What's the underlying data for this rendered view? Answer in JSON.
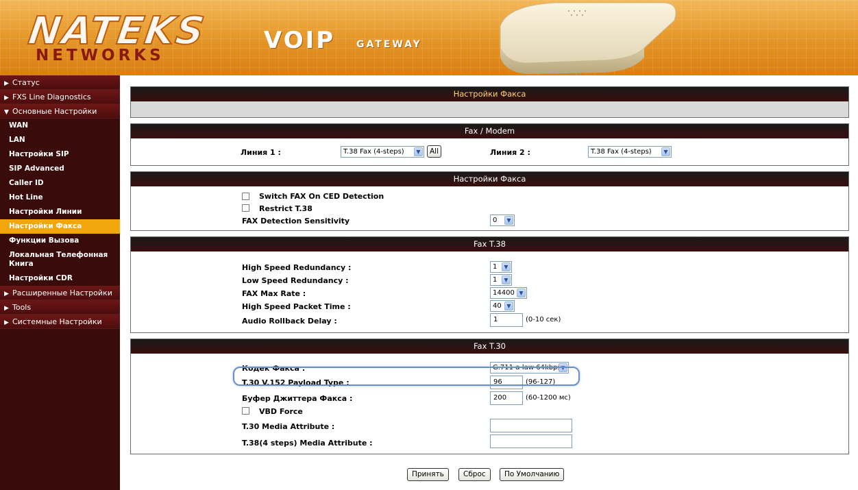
{
  "header": {
    "logo_top": "NATEKS",
    "logo_bottom": "NETWORKS",
    "product_big": "VOIP",
    "product_small": "GATEWAY"
  },
  "sidebar": {
    "sections": [
      {
        "label": "Статус",
        "expanded": false
      },
      {
        "label": "FXS Line Diagnostics",
        "expanded": false
      },
      {
        "label": "Основные Настройки",
        "expanded": true
      }
    ],
    "sub_items": [
      {
        "label": "WAN"
      },
      {
        "label": "LAN"
      },
      {
        "label": "Настройки SIP"
      },
      {
        "label": "SIP Advanced"
      },
      {
        "label": "Caller ID"
      },
      {
        "label": "Hot Line"
      },
      {
        "label": "Настройки Линии"
      },
      {
        "label": "Настройки Факса",
        "active": true
      },
      {
        "label": "Функции Вызова"
      },
      {
        "label": "Локальная Телефонная Книга"
      },
      {
        "label": "Настройки CDR"
      }
    ],
    "sections_after": [
      {
        "label": "Расширенные Настройки"
      },
      {
        "label": "Tools"
      },
      {
        "label": "Системные Настройки"
      }
    ]
  },
  "page": {
    "title": "Настройки Факса"
  },
  "fax_modem": {
    "heading": "Fax / Modem",
    "line1_label": "Линия 1 :",
    "line1_value": "T.38 Fax (4-steps)",
    "all_button": "All",
    "line2_label": "Линия 2 :",
    "line2_value": "T.38 Fax (4-steps)"
  },
  "fax_settings": {
    "heading": "Настройки Факса",
    "switch_fax_label": "Switch FAX On CED Detection",
    "restrict_label": "Restrict T.38",
    "sensitivity_label": "FAX Detection Sensitivity",
    "sensitivity_value": "0"
  },
  "t38": {
    "heading": "Fax T.38",
    "high_redundancy_label": "High Speed Redundancy :",
    "high_redundancy_value": "1",
    "low_redundancy_label": "Low Speed Redundancy :",
    "low_redundancy_value": "1",
    "max_rate_label": "FAX Max Rate :",
    "max_rate_value": "14400",
    "packet_time_label": "High Speed Packet Time :",
    "packet_time_value": "40",
    "rollback_label": "Audio Rollback Delay :",
    "rollback_value": "1",
    "rollback_hint": "(0-10 сек)"
  },
  "t30": {
    "heading": "Fax T.30",
    "codec_label": "Кодек Факса :",
    "codec_value": "G.711 a-law 64kbps",
    "payload_label": "T.30 V.152 Payload Type :",
    "payload_value": "96",
    "payload_hint": "(96-127)",
    "jitter_label": "Буфер Джиттера Факса :",
    "jitter_value": "200",
    "jitter_hint": "(60-1200 мс)",
    "vbd_label": "VBD Force",
    "media_attr_label": "T.30 Media Attribute :",
    "media_attr_value": "",
    "media_attr4_label": "T.38(4 steps) Media Attribute :",
    "media_attr4_value": ""
  },
  "buttons": {
    "apply": "Принять",
    "reset": "Сброс",
    "default": "По Умолчанию"
  },
  "colors": {
    "header_orange": "#e79a2c",
    "sidebar_bg": "#3a0b0b",
    "active_item": "#f2a60c",
    "panel_head": "#1a1a1a",
    "highlight_ring": "#6a8fc4"
  }
}
